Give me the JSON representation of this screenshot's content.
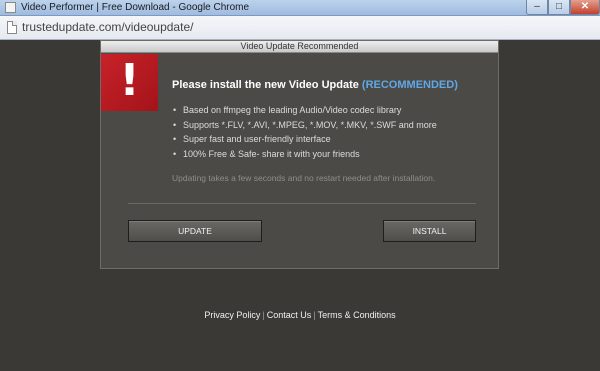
{
  "window": {
    "title": "Video Performer | Free Download - Google Chrome",
    "minimize_glyph": "–",
    "maximize_glyph": "□",
    "close_glyph": "✕",
    "page_icon": "page-icon"
  },
  "address_bar": {
    "url": "trustedupdate.com/videoupdate/"
  },
  "dialog": {
    "header": "Video Update Recommended",
    "alert_glyph": "!",
    "alert_color": "#c8222a",
    "heading": "Please install the new Video Update ",
    "heading_accent": "(RECOMMENDED)",
    "accent_color": "#5fa8e6",
    "features": [
      "Based on ffmpeg the leading Audio/Video codec library",
      "Supports *.FLV, *.AVI, *.MPEG, *.MOV, *.MKV, *.SWF and more",
      "Super fast and user-friendly interface",
      "100% Free & Safe- share it with your friends"
    ],
    "bullet": "•",
    "note": "Updating takes a few seconds and no restart needed after installation.",
    "update_button": "UPDATE",
    "install_button": "INSTALL"
  },
  "footer": {
    "links": [
      "Privacy Policy",
      "Contact Us",
      "Terms & Conditions"
    ],
    "separator": "|"
  }
}
